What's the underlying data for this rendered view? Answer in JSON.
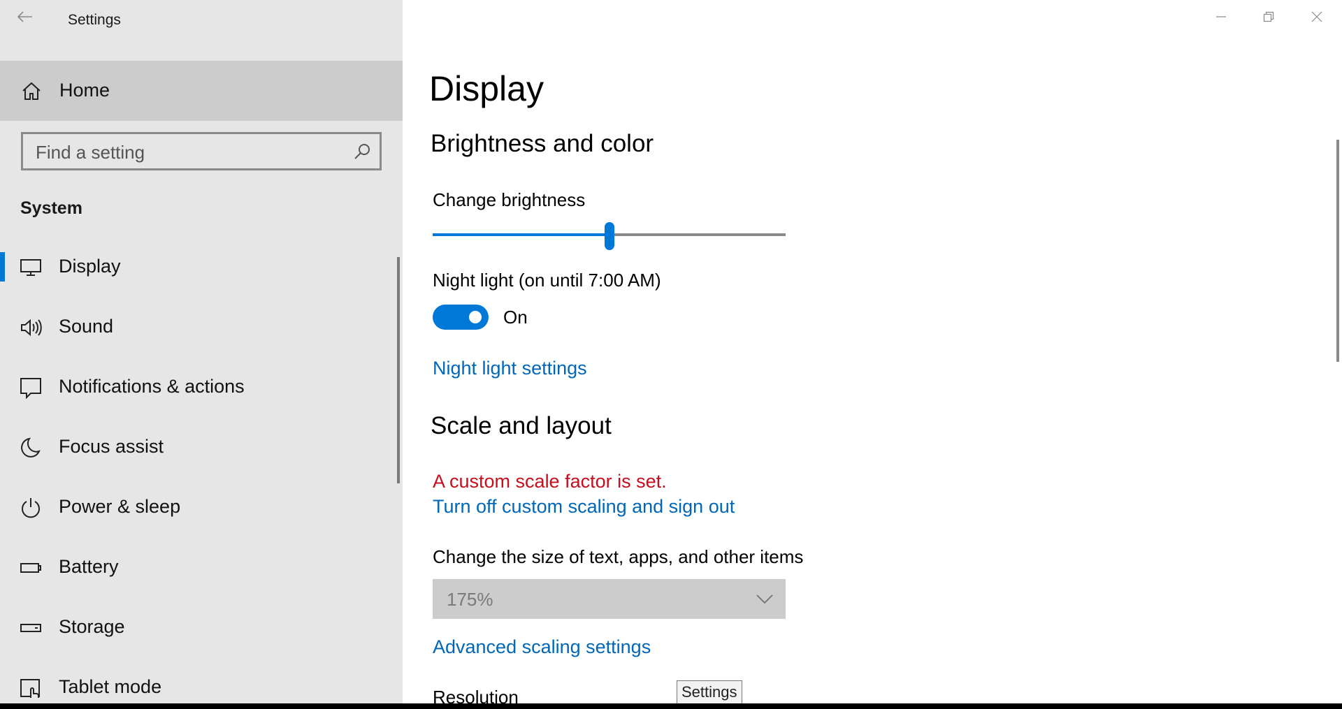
{
  "window": {
    "title": "Settings"
  },
  "sidebar": {
    "home_label": "Home",
    "search_placeholder": "Find a setting",
    "group_title": "System",
    "items": [
      {
        "label": "Display",
        "icon": "monitor-icon",
        "selected": true
      },
      {
        "label": "Sound",
        "icon": "speaker-icon",
        "selected": false
      },
      {
        "label": "Notifications & actions",
        "icon": "message-icon",
        "selected": false
      },
      {
        "label": "Focus assist",
        "icon": "moon-icon",
        "selected": false
      },
      {
        "label": "Power & sleep",
        "icon": "power-icon",
        "selected": false
      },
      {
        "label": "Battery",
        "icon": "battery-icon",
        "selected": false
      },
      {
        "label": "Storage",
        "icon": "storage-icon",
        "selected": false
      },
      {
        "label": "Tablet mode",
        "icon": "tablet-mode-icon",
        "selected": false
      }
    ]
  },
  "main": {
    "page_title": "Display",
    "brightness_section": {
      "title": "Brightness and color",
      "brightness_label": "Change brightness",
      "brightness_value": 0.5,
      "night_light_label": "Night light (on until 7:00 AM)",
      "night_light_state": "On",
      "night_light_settings_link": "Night light settings"
    },
    "scale_section": {
      "title": "Scale and layout",
      "warning": "A custom scale factor is set.",
      "turn_off_link": "Turn off custom scaling and sign out",
      "size_label": "Change the size of text, apps, and other items",
      "size_value": "175%",
      "advanced_link": "Advanced scaling settings",
      "resolution_label": "Resolution"
    }
  },
  "tooltip": "Settings",
  "colors": {
    "accent": "#0078d7",
    "link": "#0067b8",
    "warning": "#c50f1f",
    "sidebar_bg": "#e6e6e6"
  }
}
